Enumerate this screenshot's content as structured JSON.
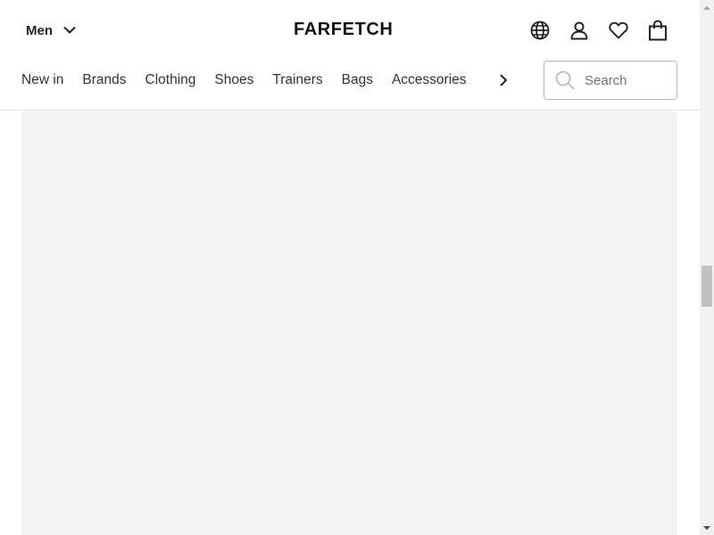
{
  "header": {
    "gender_selector": {
      "label": "Men",
      "icon": "chevron-down-icon"
    },
    "logo": "FARFETCH",
    "icons": [
      "globe-icon",
      "account-icon",
      "wishlist-heart-icon",
      "shopping-bag-icon"
    ]
  },
  "nav": {
    "items": [
      {
        "label": "New in"
      },
      {
        "label": "Brands"
      },
      {
        "label": "Clothing"
      },
      {
        "label": "Shoes"
      },
      {
        "label": "Trainers"
      },
      {
        "label": "Bags"
      },
      {
        "label": "Accessories"
      }
    ],
    "next_icon": "chevron-right-icon"
  },
  "search": {
    "placeholder": "Search",
    "value": "",
    "icon": "search-icon"
  },
  "colors": {
    "panel_background": "#f3f3f3",
    "text": "#222222",
    "border": "#e2e2e2"
  }
}
